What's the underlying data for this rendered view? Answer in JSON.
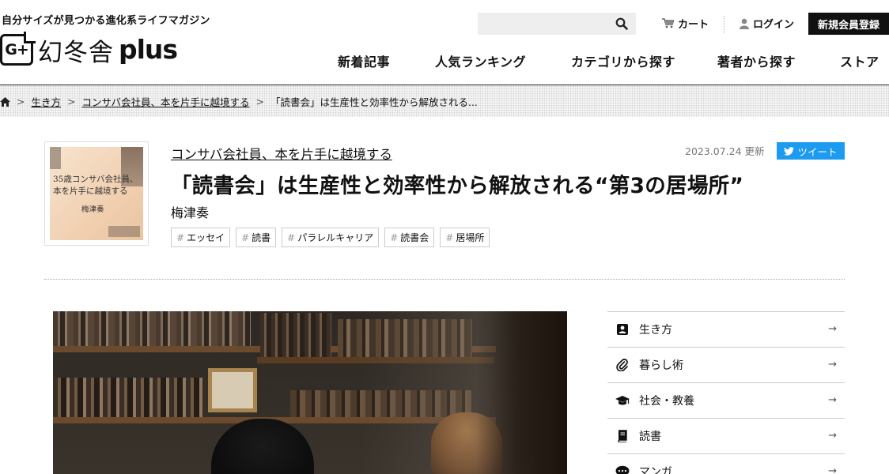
{
  "header": {
    "tagline": "自分サイズが見つかる進化系ライフマガジン",
    "logo_badge": "G+",
    "logo_jp": "幻冬舎",
    "logo_plus": "plus",
    "cart": "カート",
    "login": "ログイン",
    "signup": "新規会員登録"
  },
  "nav": [
    "新着記事",
    "人気ランキング",
    "カテゴリから探す",
    "著者から探す",
    "ストア"
  ],
  "breadcrumb": {
    "home_icon": "home-icon",
    "items": [
      "生き方",
      "コンサバ会社員、本を片手に越境する",
      "「読書会」は生産性と効率性から解放される..."
    ]
  },
  "article": {
    "thumb_title_1": "35歳コンサバ会社員、",
    "thumb_title_2": "本を片手に越境する",
    "thumb_author": "梅津奏",
    "series": "コンサバ会社員、本を片手に越境する",
    "date": "2023.07.24 更新",
    "tweet": "ツイート",
    "title": "「読書会」は生産性と効率性から解放される“第3の居場所”",
    "author": "梅津奏",
    "tags": [
      "エッセイ",
      "読書",
      "パラレルキャリア",
      "読書会",
      "居場所"
    ]
  },
  "sidebar": {
    "items": [
      {
        "label": "生き方",
        "icon": "person-card-icon"
      },
      {
        "label": "暮らし術",
        "icon": "paperclip-icon"
      },
      {
        "label": "社会・教養",
        "icon": "graduation-cap-icon"
      },
      {
        "label": "読書",
        "icon": "book-icon"
      },
      {
        "label": "マンガ",
        "icon": "speech-bubble-icon"
      }
    ],
    "arrow": "→"
  },
  "colors": {
    "tweet": "#1d9bf0",
    "signup_bg": "#111111"
  }
}
